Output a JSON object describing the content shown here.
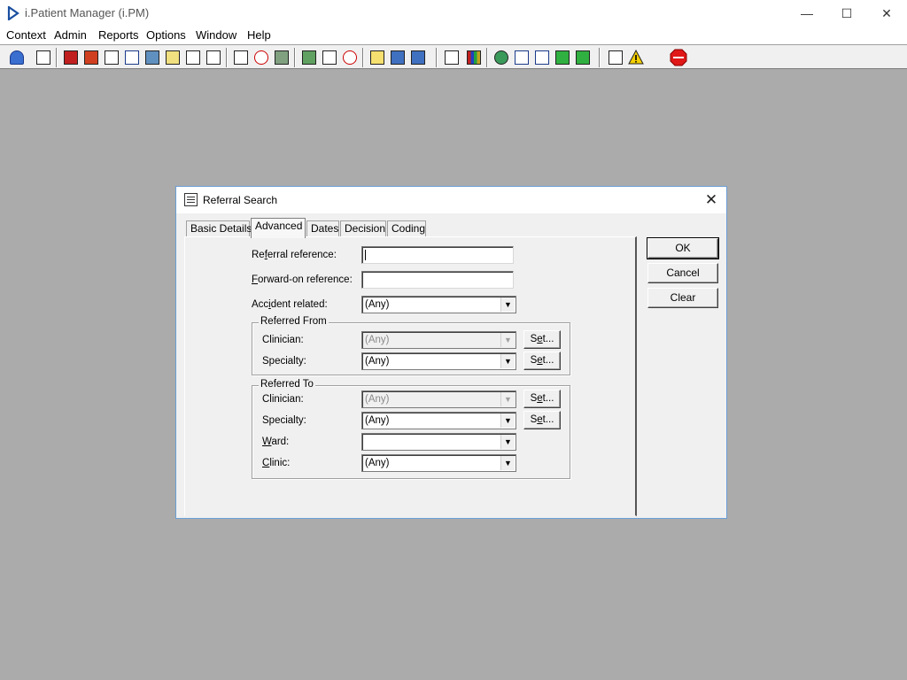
{
  "window": {
    "title": "i.Patient Manager (i.PM)",
    "controls": {
      "minimize": "—",
      "maximize": "☐",
      "close": "✕"
    }
  },
  "menu": [
    "Context",
    "Admin",
    "Reports",
    "Options",
    "Window",
    "Help"
  ],
  "toolbar_icons": [
    "patient-icon",
    "printer-icon",
    "book-icon",
    "house-icon",
    "search-doc-icon",
    "mail-icon",
    "clinician-icon",
    "notes-icon",
    "referral-icon",
    "transport-icon",
    "search-glass-icon",
    "clock-icon",
    "monitor-icon",
    "certificate-icon",
    "form-icon",
    "stopwatch-icon",
    "memo-icon",
    "bed-icon",
    "ambulance-icon",
    "document-icon",
    "chart-icon",
    "globe-icon",
    "check-list-icon",
    "task-icon",
    "transfer-in-icon",
    "transfer-out-icon",
    "swap-icon",
    "warning-icon",
    "exit-icon"
  ],
  "colors": {
    "desktop": "#ababab",
    "dialog_border": "#6a9fd6",
    "exit": "#e01818",
    "warning": "#f5d000"
  },
  "dialog": {
    "title": "Referral Search",
    "close": "✕",
    "tabs": [
      "Basic Details",
      "Advanced",
      "Dates",
      "Decision",
      "Coding"
    ],
    "active_tab": "Advanced",
    "fields": {
      "referral_reference": {
        "label_pre": "Re",
        "label_key": "f",
        "label_post": "erral reference:",
        "value": ""
      },
      "forward_on_reference": {
        "label_pre": "",
        "label_key": "F",
        "label_post": "orward-on reference:",
        "value": ""
      },
      "accident_related": {
        "label_pre": "Acc",
        "label_key": "i",
        "label_post": "dent related:",
        "value": "(Any)"
      }
    },
    "referred_from": {
      "legend": "Referred From",
      "clinician": {
        "label_pre": "Clinician:",
        "value": "(Any)"
      },
      "specialty": {
        "label_pre": "Specialty:",
        "value": "(Any)"
      },
      "set_label_pre": "S",
      "set_label_key": "e",
      "set_label_post": "t..."
    },
    "referred_to": {
      "legend": "Referred To",
      "clinician": {
        "label_pre": "Clinician:",
        "value": "(Any)"
      },
      "specialty": {
        "label_pre": "Specialty:",
        "value": "(Any)"
      },
      "ward": {
        "label_key": "W",
        "label_post": "ard:",
        "value": ""
      },
      "clinic": {
        "label_key": "C",
        "label_post": "linic:",
        "value": "(Any)"
      },
      "set_label_pre": "S",
      "set_label_key": "e",
      "set_label_post": "t..."
    },
    "buttons": {
      "ok": "OK",
      "cancel": "Cancel",
      "clear": "Clear"
    }
  }
}
